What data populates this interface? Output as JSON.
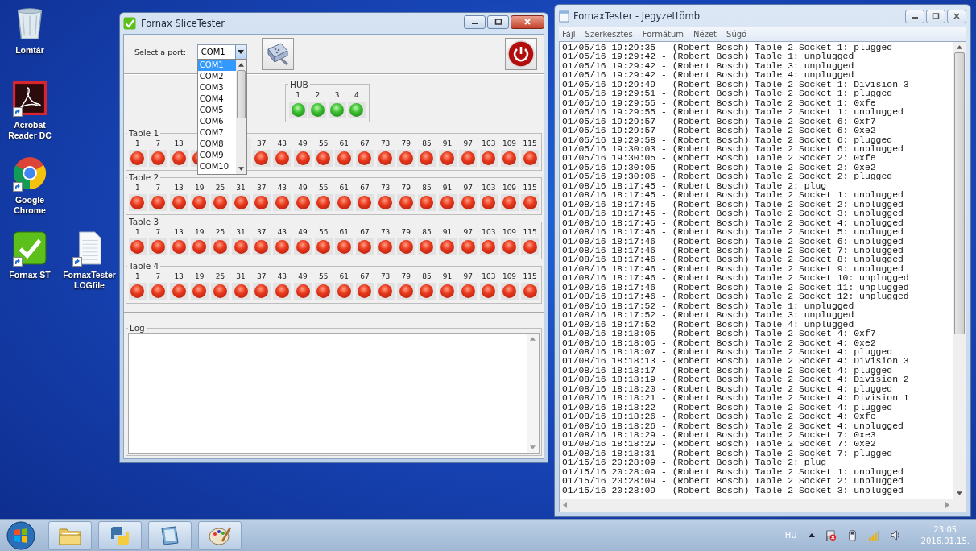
{
  "desktop_icons": [
    {
      "label": "Lomtár",
      "kind": "recycle-bin",
      "shortcut": false
    },
    {
      "label": "Acrobat Reader DC",
      "kind": "acrobat",
      "shortcut": true
    },
    {
      "label": "Google Chrome",
      "kind": "chrome",
      "shortcut": true
    },
    {
      "label": "Fornax ST",
      "kind": "fornax",
      "shortcut": true
    },
    {
      "label": "FornaxTester LOGfile",
      "kind": "document",
      "shortcut": true
    }
  ],
  "fornax": {
    "title": "Fornax SliceTester",
    "port_select": {
      "label": "Select a port:",
      "value": "COM1",
      "expanded": true,
      "options": [
        {
          "label": "COM1",
          "selected": true
        },
        {
          "label": "COM2",
          "selected": false
        },
        {
          "label": "COM3",
          "selected": false
        },
        {
          "label": "COM4",
          "selected": false
        },
        {
          "label": "COM5",
          "selected": false
        },
        {
          "label": "COM6",
          "selected": false
        },
        {
          "label": "COM7",
          "selected": false
        },
        {
          "label": "COM8",
          "selected": false
        },
        {
          "label": "COM9",
          "selected": false
        },
        {
          "label": "COM10",
          "selected": false
        }
      ]
    },
    "hub": {
      "label": "HUB",
      "ports": [
        {
          "label": "1",
          "on": true
        },
        {
          "label": "2",
          "on": true
        },
        {
          "label": "3",
          "on": true
        },
        {
          "label": "4",
          "on": true
        }
      ]
    },
    "tables": [
      {
        "label": "Table 1",
        "sockets": [
          {
            "label": "1",
            "on": false
          },
          {
            "label": "7",
            "on": false
          },
          {
            "label": "13",
            "on": false
          },
          {
            "on": false
          },
          {
            "covered": true
          },
          {
            "covered": true
          },
          {
            "label": "37",
            "on": false
          },
          {
            "label": "43",
            "on": false
          },
          {
            "label": "49",
            "on": false
          },
          {
            "label": "55",
            "on": false
          },
          {
            "label": "61",
            "on": false
          },
          {
            "label": "67",
            "on": false
          },
          {
            "label": "73",
            "on": false
          },
          {
            "label": "79",
            "on": false
          },
          {
            "label": "85",
            "on": false
          },
          {
            "label": "91",
            "on": false
          },
          {
            "label": "97",
            "on": false
          },
          {
            "label": "103",
            "on": false
          },
          {
            "label": "109",
            "on": false
          },
          {
            "label": "115",
            "on": false
          }
        ]
      },
      {
        "label": "Table 2",
        "sockets": [
          {
            "label": "1",
            "on": false
          },
          {
            "label": "7",
            "on": false
          },
          {
            "label": "13",
            "on": false
          },
          {
            "label": "19",
            "on": false
          },
          {
            "label": "25",
            "on": false
          },
          {
            "label": "31",
            "on": false
          },
          {
            "label": "37",
            "on": false
          },
          {
            "label": "43",
            "on": false
          },
          {
            "label": "49",
            "on": false
          },
          {
            "label": "55",
            "on": false
          },
          {
            "label": "61",
            "on": false
          },
          {
            "label": "67",
            "on": false
          },
          {
            "label": "73",
            "on": false
          },
          {
            "label": "79",
            "on": false
          },
          {
            "label": "85",
            "on": false
          },
          {
            "label": "91",
            "on": false
          },
          {
            "label": "97",
            "on": false
          },
          {
            "label": "103",
            "on": false
          },
          {
            "label": "109",
            "on": false
          },
          {
            "label": "115",
            "on": false
          }
        ]
      },
      {
        "label": "Table 3",
        "sockets": [
          {
            "label": "1",
            "on": false
          },
          {
            "label": "7",
            "on": false
          },
          {
            "label": "13",
            "on": false
          },
          {
            "label": "19",
            "on": false
          },
          {
            "label": "25",
            "on": false
          },
          {
            "label": "31",
            "on": false
          },
          {
            "label": "37",
            "on": false
          },
          {
            "label": "43",
            "on": false
          },
          {
            "label": "49",
            "on": false
          },
          {
            "label": "55",
            "on": false
          },
          {
            "label": "61",
            "on": false
          },
          {
            "label": "67",
            "on": false
          },
          {
            "label": "73",
            "on": false
          },
          {
            "label": "79",
            "on": false
          },
          {
            "label": "85",
            "on": false
          },
          {
            "label": "91",
            "on": false
          },
          {
            "label": "97",
            "on": false
          },
          {
            "label": "103",
            "on": false
          },
          {
            "label": "109",
            "on": false
          },
          {
            "label": "115",
            "on": false
          }
        ]
      },
      {
        "label": "Table 4",
        "sockets": [
          {
            "label": "1",
            "on": false
          },
          {
            "label": "7",
            "on": false
          },
          {
            "label": "13",
            "on": false
          },
          {
            "label": "19",
            "on": false
          },
          {
            "label": "25",
            "on": false
          },
          {
            "label": "31",
            "on": false
          },
          {
            "label": "37",
            "on": false
          },
          {
            "label": "43",
            "on": false
          },
          {
            "label": "49",
            "on": false
          },
          {
            "label": "55",
            "on": false
          },
          {
            "label": "61",
            "on": false
          },
          {
            "label": "67",
            "on": false
          },
          {
            "label": "73",
            "on": false
          },
          {
            "label": "79",
            "on": false
          },
          {
            "label": "85",
            "on": false
          },
          {
            "label": "91",
            "on": false
          },
          {
            "label": "97",
            "on": false
          },
          {
            "label": "103",
            "on": false
          },
          {
            "label": "109",
            "on": false
          },
          {
            "label": "115",
            "on": false
          }
        ]
      }
    ],
    "log": {
      "label": "Log"
    }
  },
  "notepad": {
    "title": "FornaxTester - Jegyzettömb",
    "menu": [
      "Fájl",
      "Szerkesztés",
      "Formátum",
      "Nézet",
      "Súgó"
    ],
    "lines": [
      "01/05/16 19:29:35 - (Robert Bosch) Table 2 Socket 1: plugged",
      "01/05/16 19:29:42 - (Robert Bosch) Table 1: unplugged",
      "01/05/16 19:29:42 - (Robert Bosch) Table 3: unplugged",
      "01/05/16 19:29:42 - (Robert Bosch) Table 4: unplugged",
      "01/05/16 19:29:49 - (Robert Bosch) Table 2 Socket 1: Division 3",
      "01/05/16 19:29:51 - (Robert Bosch) Table 2 Socket 1: plugged",
      "01/05/16 19:29:55 - (Robert Bosch) Table 2 Socket 1: 0xfe",
      "01/05/16 19:29:55 - (Robert Bosch) Table 2 Socket 1: unplugged",
      "01/05/16 19:29:57 - (Robert Bosch) Table 2 Socket 6: 0xf7",
      "01/05/16 19:29:57 - (Robert Bosch) Table 2 Socket 6: 0xe2",
      "01/05/16 19:29:58 - (Robert Bosch) Table 2 Socket 6: plugged",
      "01/05/16 19:30:03 - (Robert Bosch) Table 2 Socket 6: unplugged",
      "01/05/16 19:30:05 - (Robert Bosch) Table 2 Socket 2: 0xfe",
      "01/05/16 19:30:05 - (Robert Bosch) Table 2 Socket 2: 0xe2",
      "01/05/16 19:30:06 - (Robert Bosch) Table 2 Socket 2: plugged",
      "01/08/16 18:17:45 - (Robert Bosch) Table 2: plug",
      "01/08/16 18:17:45 - (Robert Bosch) Table 2 Socket 1: unplugged",
      "01/08/16 18:17:45 - (Robert Bosch) Table 2 Socket 2: unplugged",
      "01/08/16 18:17:45 - (Robert Bosch) Table 2 Socket 3: unplugged",
      "01/08/16 18:17:45 - (Robert Bosch) Table 2 Socket 4: unplugged",
      "01/08/16 18:17:46 - (Robert Bosch) Table 2 Socket 5: unplugged",
      "01/08/16 18:17:46 - (Robert Bosch) Table 2 Socket 6: unplugged",
      "01/08/16 18:17:46 - (Robert Bosch) Table 2 Socket 7: unplugged",
      "01/08/16 18:17:46 - (Robert Bosch) Table 2 Socket 8: unplugged",
      "01/08/16 18:17:46 - (Robert Bosch) Table 2 Socket 9: unplugged",
      "01/08/16 18:17:46 - (Robert Bosch) Table 2 Socket 10: unplugged",
      "01/08/16 18:17:46 - (Robert Bosch) Table 2 Socket 11: unplugged",
      "01/08/16 18:17:46 - (Robert Bosch) Table 2 Socket 12: unplugged",
      "01/08/16 18:17:52 - (Robert Bosch) Table 1: unplugged",
      "01/08/16 18:17:52 - (Robert Bosch) Table 3: unplugged",
      "01/08/16 18:17:52 - (Robert Bosch) Table 4: unplugged",
      "01/08/16 18:18:05 - (Robert Bosch) Table 2 Socket 4: 0xf7",
      "01/08/16 18:18:05 - (Robert Bosch) Table 2 Socket 4: 0xe2",
      "01/08/16 18:18:07 - (Robert Bosch) Table 2 Socket 4: plugged",
      "01/08/16 18:18:13 - (Robert Bosch) Table 2 Socket 4: Division 3",
      "01/08/16 18:18:17 - (Robert Bosch) Table 2 Socket 4: plugged",
      "01/08/16 18:18:19 - (Robert Bosch) Table 2 Socket 4: Division 2",
      "01/08/16 18:18:20 - (Robert Bosch) Table 2 Socket 4: plugged",
      "01/08/16 18:18:21 - (Robert Bosch) Table 2 Socket 4: Division 1",
      "01/08/16 18:18:22 - (Robert Bosch) Table 2 Socket 4: plugged",
      "01/08/16 18:18:26 - (Robert Bosch) Table 2 Socket 4: 0xfe",
      "01/08/16 18:18:26 - (Robert Bosch) Table 2 Socket 4: unplugged",
      "01/08/16 18:18:29 - (Robert Bosch) Table 2 Socket 7: 0xe3",
      "01/08/16 18:18:29 - (Robert Bosch) Table 2 Socket 7: 0xe2",
      "01/08/16 18:18:31 - (Robert Bosch) Table 2 Socket 7: plugged",
      "01/15/16 20:28:09 - (Robert Bosch) Table 2: plug",
      "01/15/16 20:28:09 - (Robert Bosch) Table 2 Socket 1: unplugged",
      "01/15/16 20:28:09 - (Robert Bosch) Table 2 Socket 2: unplugged",
      "01/15/16 20:28:09 - (Robert Bosch) Table 2 Socket 3: unplugged"
    ]
  },
  "taskbar": {
    "pinned": [
      {
        "kind": "folder"
      },
      {
        "kind": "python"
      },
      {
        "kind": "tile"
      },
      {
        "kind": "palette"
      }
    ],
    "tray": {
      "language": "HU",
      "time": "23:05",
      "date": "2016.01.15."
    }
  }
}
